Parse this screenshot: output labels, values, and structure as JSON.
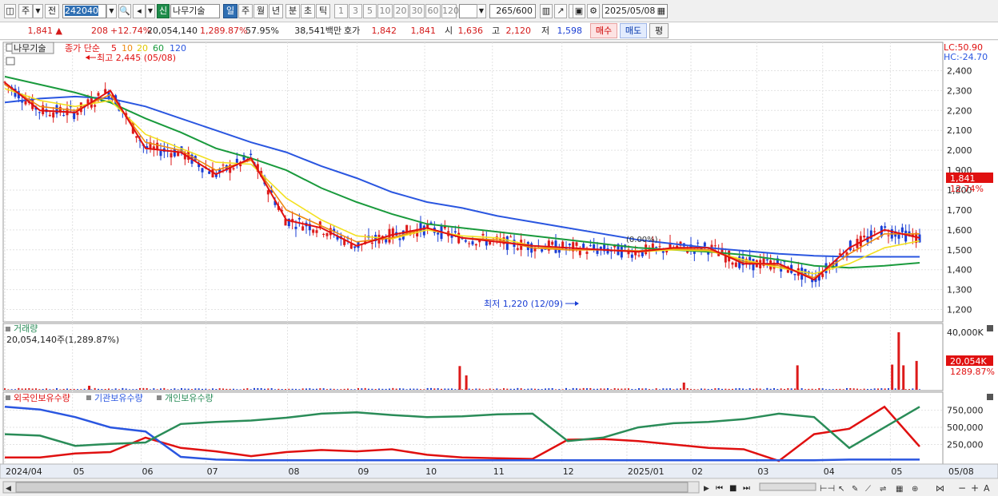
{
  "toolbar": {
    "mode_label": "주",
    "prev_label": "전",
    "code_value": "242040",
    "new_badge": "신",
    "stock_name": "나무기술",
    "periods": [
      "일",
      "주",
      "월",
      "년",
      "분",
      "초",
      "틱"
    ],
    "intervals": [
      "1",
      "3",
      "5",
      "10",
      "20",
      "30",
      "60",
      "120"
    ],
    "count_value": "265",
    "count_total": "/600",
    "date_value": "2025/05/08"
  },
  "quote": {
    "price": "1,841",
    "arrow": "▲",
    "change": "208",
    "change_pct": "+12.74%",
    "volume": "20,054,140",
    "volume_pct": "1,289.87%",
    "turnover_pct": "57.95%",
    "amount": "38,541백만",
    "hoga_label": "호가",
    "ask": "1,842",
    "bid": "1,841",
    "open_label": "시",
    "open": "1,636",
    "high_label": "고",
    "high": "2,120",
    "low_label": "저",
    "low": "1,598",
    "buy_label": "매수",
    "sell_label": "매도",
    "eval_label": "평"
  },
  "price_panel": {
    "legend_name": "나무기술",
    "legend_ma_prefix": "종가 단순",
    "ma_labels": [
      "5",
      "10",
      "20",
      "60",
      "120"
    ],
    "high_annotation": "최고 2,445 (05/08)",
    "low_annotation": "최저 1,220 (12/09)",
    "mid_annotation": "(0.00%)",
    "lc_label": "LC:50.90",
    "hc_label": "HC:-24.70",
    "price_tag": "1,841",
    "pct_tag": "12.74%"
  },
  "volume_panel": {
    "title": "거래량",
    "value_line": "20,054,140주(1,289.87%)",
    "tag_value": "20,054K",
    "tag_pct": "1289.87%"
  },
  "holding_panel": {
    "legend": [
      "외국인보유수량",
      "기관보유수량",
      "개인보유수량"
    ]
  },
  "colors": {
    "candle_up": "#dd1a1a",
    "ma5": "#e01010",
    "ma10": "#ee8a10",
    "ma20": "#f3e020",
    "ma60": "#199a3c",
    "ma120": "#2a56e0",
    "foreign": "#e01010",
    "institution": "#2a56e0",
    "individual": "#2a8c58"
  },
  "chart_data": [
    {
      "type": "line",
      "title": "",
      "x": [
        "2024/04",
        "05",
        "06",
        "07",
        "08",
        "09",
        "10",
        "11",
        "12",
        "2025/01",
        "02",
        "03",
        "04",
        "05"
      ],
      "x_axis_end_label": "05/08",
      "ylim": [
        1150,
        2450
      ],
      "y_ticks": [
        1200,
        1300,
        1400,
        1500,
        1600,
        1700,
        1800,
        1900,
        2000,
        2100,
        2200,
        2300,
        2400
      ],
      "series": [
        {
          "name": "5",
          "values": [
            2340,
            2200,
            2190,
            2300,
            2010,
            1990,
            1880,
            1960,
            1650,
            1610,
            1520,
            1575,
            1610,
            1560,
            1540,
            1520,
            1510,
            1500,
            1490,
            1510,
            1510,
            1430,
            1430,
            1350,
            1510,
            1600,
            1560
          ]
        },
        {
          "name": "10",
          "values": [
            2330,
            2220,
            2200,
            2280,
            2040,
            2000,
            1900,
            1950,
            1700,
            1620,
            1540,
            1560,
            1610,
            1560,
            1550,
            1510,
            1500,
            1500,
            1495,
            1505,
            1500,
            1440,
            1420,
            1360,
            1480,
            1580,
            1580
          ]
        },
        {
          "name": "20",
          "values": [
            2310,
            2250,
            2220,
            2250,
            2080,
            2010,
            1940,
            1930,
            1760,
            1650,
            1570,
            1555,
            1600,
            1570,
            1560,
            1520,
            1500,
            1500,
            1490,
            1500,
            1495,
            1450,
            1410,
            1380,
            1430,
            1510,
            1545
          ]
        },
        {
          "name": "60",
          "values": [
            2370,
            2330,
            2290,
            2240,
            2160,
            2090,
            2010,
            1960,
            1900,
            1810,
            1740,
            1680,
            1630,
            1610,
            1590,
            1570,
            1550,
            1530,
            1510,
            1500,
            1490,
            1475,
            1450,
            1420,
            1410,
            1420,
            1435
          ]
        },
        {
          "name": "120",
          "values": [
            2240,
            2260,
            2270,
            2260,
            2220,
            2160,
            2100,
            2040,
            1990,
            1920,
            1860,
            1790,
            1740,
            1710,
            1670,
            1640,
            1610,
            1580,
            1550,
            1530,
            1510,
            1495,
            1480,
            1470,
            1465,
            1465,
            1465
          ]
        }
      ]
    },
    {
      "type": "bar",
      "title": "거래량",
      "ylim": [
        0,
        40000000
      ],
      "y_ticks": [
        "40,000K"
      ],
      "spikes": [
        {
          "x_frac": 0.09,
          "value": 2800000
        },
        {
          "x_frac": 0.485,
          "value": 16500000
        },
        {
          "x_frac": 0.492,
          "value": 10000000
        },
        {
          "x_frac": 0.724,
          "value": 5000000
        },
        {
          "x_frac": 0.845,
          "value": 17000000
        },
        {
          "x_frac": 0.946,
          "value": 17500000
        },
        {
          "x_frac": 0.953,
          "value": 40000000
        },
        {
          "x_frac": 0.958,
          "value": 17000000
        },
        {
          "x_frac": 0.972,
          "value": 20054140
        }
      ]
    },
    {
      "type": "line",
      "title": "",
      "ylim": [
        0,
        850000
      ],
      "y_ticks": [
        250000,
        500000,
        750000
      ],
      "series": [
        {
          "name": "외국인보유수량",
          "values": [
            60000,
            60000,
            120000,
            140000,
            350000,
            200000,
            150000,
            80000,
            140000,
            170000,
            150000,
            180000,
            100000,
            60000,
            50000,
            40000,
            320000,
            330000,
            300000,
            250000,
            200000,
            180000,
            10000,
            400000,
            480000,
            800000,
            220000
          ]
        },
        {
          "name": "기관보유수량",
          "values": [
            800000,
            760000,
            650000,
            500000,
            440000,
            70000,
            30000,
            20000,
            20000,
            20000,
            20000,
            20000,
            20000,
            20000,
            20000,
            20000,
            20000,
            20000,
            20000,
            20000,
            20000,
            20000,
            20000,
            20000,
            30000,
            30000,
            30000
          ]
        },
        {
          "name": "개인보유수량",
          "values": [
            400000,
            380000,
            230000,
            260000,
            280000,
            550000,
            580000,
            600000,
            640000,
            700000,
            720000,
            680000,
            650000,
            660000,
            690000,
            700000,
            300000,
            350000,
            500000,
            560000,
            580000,
            620000,
            700000,
            650000,
            200000,
            500000,
            800000
          ]
        }
      ]
    }
  ]
}
